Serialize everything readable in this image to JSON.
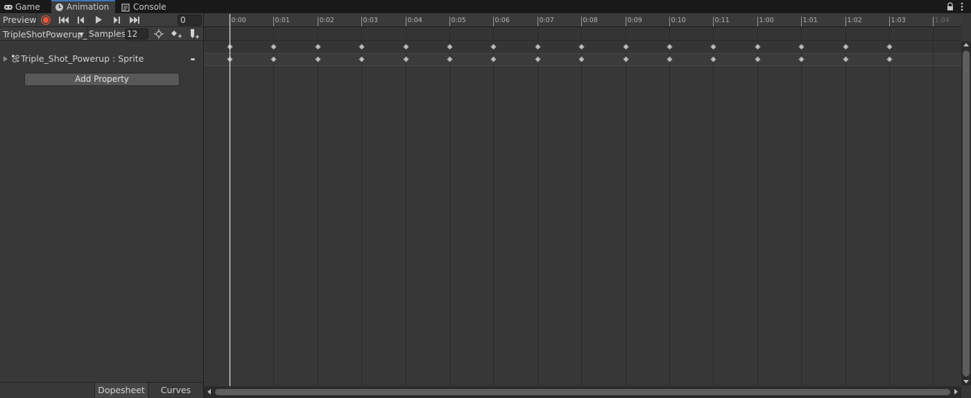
{
  "tabs": [
    {
      "label": "Game",
      "icon": "gamepad-icon"
    },
    {
      "label": "Animation",
      "icon": "clock-icon",
      "active": true
    },
    {
      "label": "Console",
      "icon": "console-icon"
    }
  ],
  "toolbar": {
    "preview_label": "Preview",
    "frame_value": "0",
    "clip_name": "TripleShotPowerup_",
    "samples_label": "Samples",
    "samples_value": "12"
  },
  "properties": [
    {
      "label": "Triple_Shot_Powerup : Sprite"
    }
  ],
  "add_property_label": "Add Property",
  "view_tabs": {
    "dopesheet": "Dopesheet",
    "curves": "Curves"
  },
  "timeline": {
    "labels": [
      "0:00",
      "0:01",
      "0:02",
      "0:03",
      "0:04",
      "0:05",
      "0:06",
      "0:07",
      "0:08",
      "0:09",
      "0:10",
      "0:11",
      "1:00",
      "1:01",
      "1:02",
      "1:03",
      "1:04"
    ],
    "keyframe_count": 16,
    "playhead_frame": 0
  },
  "colors": {
    "record_button": "#e8563a",
    "active_tab_accent": "#3a79bb",
    "keyframe": "#bdbdbd",
    "playhead": "#e6e6e6"
  }
}
